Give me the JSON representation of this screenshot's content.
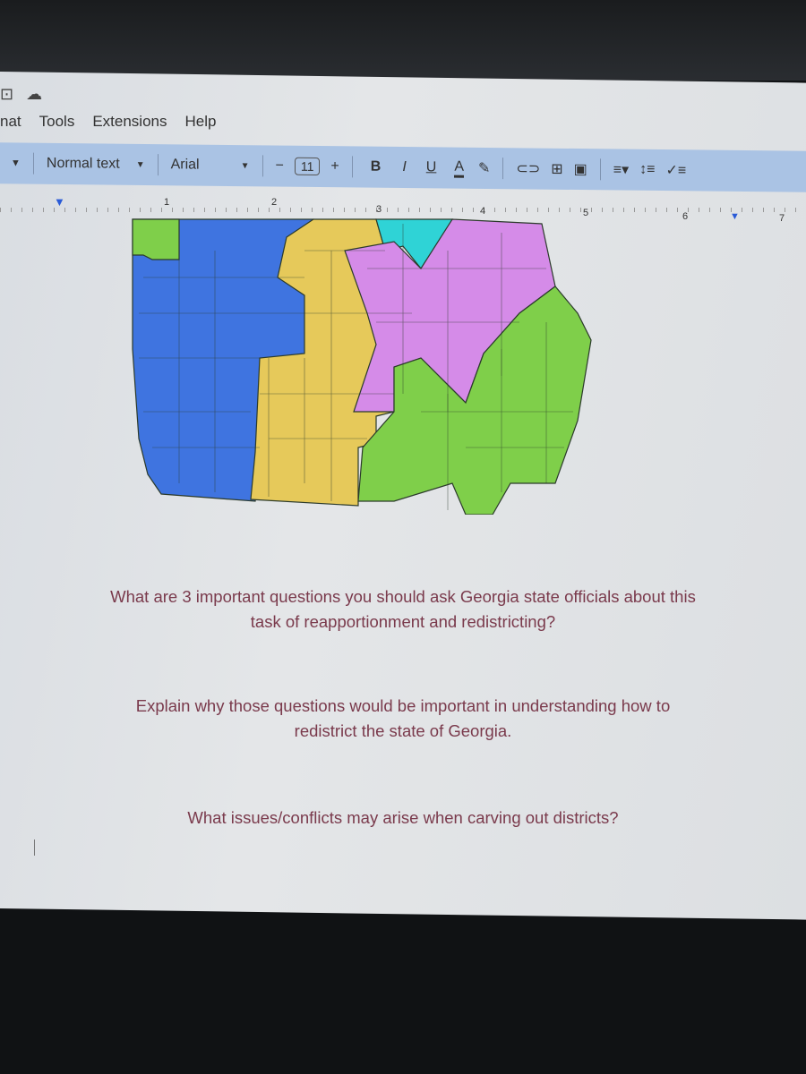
{
  "menu": {
    "items": [
      "nat",
      "Tools",
      "Extensions",
      "Help"
    ]
  },
  "toolbar": {
    "style": "Normal text",
    "font": "Arial",
    "font_size": "11",
    "minus": "−",
    "plus": "+",
    "bold": "B",
    "italic": "I",
    "underline": "U",
    "text_color": "A"
  },
  "ruler": {
    "marks": [
      "1",
      "2",
      "3",
      "4",
      "5",
      "6",
      "7"
    ]
  },
  "map": {
    "colors": {
      "blue": "#3f74e0",
      "yellow": "#e6c95a",
      "teal": "#2fd3d6",
      "pink": "#d58be8",
      "green": "#7fcf4a"
    }
  },
  "document": {
    "q1_line1": "What are 3 important questions you should ask Georgia state officials about this",
    "q1_line2": "task of reapportionment and redistricting?",
    "q2_line1": "Explain why those questions would be important in understanding how to",
    "q2_line2": "redistrict the state of Georgia.",
    "q3": "What issues/conflicts may arise when carving out districts?"
  }
}
